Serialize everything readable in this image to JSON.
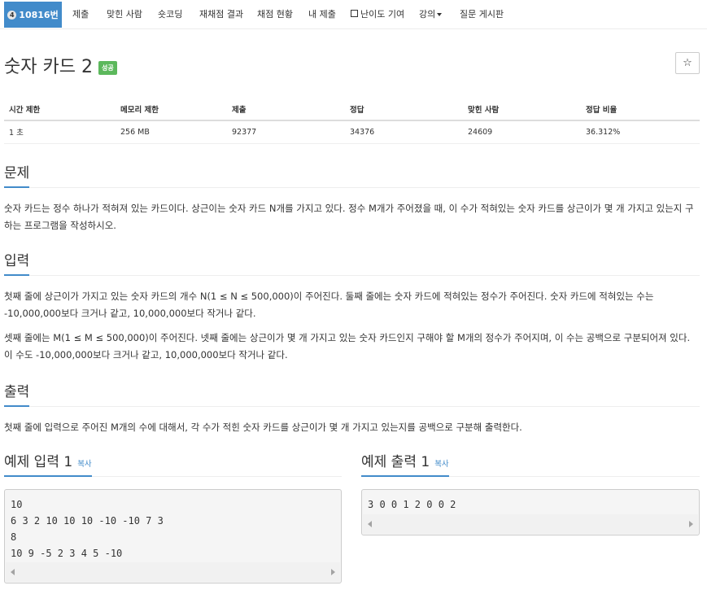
{
  "nav": {
    "problem_id": "10816번",
    "problem_icon": "4",
    "items": [
      "제출",
      "맞힌 사람",
      "숏코딩",
      "재채점 결과",
      "채점 현황",
      "내 제출",
      "난이도 기여",
      "강의",
      "질문 게시판"
    ]
  },
  "problem": {
    "title": "숫자 카드 2",
    "status": "성공",
    "star": "☆"
  },
  "info": {
    "headers": [
      "시간 제한",
      "메모리 제한",
      "제출",
      "정답",
      "맞힌 사람",
      "정답 비율"
    ],
    "values": [
      "1 초",
      "256 MB",
      "92377",
      "34376",
      "24609",
      "36.312%"
    ]
  },
  "sections": {
    "description": {
      "heading": "문제",
      "text": "숫자 카드는 정수 하나가 적혀져 있는 카드이다. 상근이는 숫자 카드 N개를 가지고 있다. 정수 M개가 주어졌을 때, 이 수가 적혀있는 숫자 카드를 상근이가 몇 개 가지고 있는지 구하는 프로그램을 작성하시오."
    },
    "input": {
      "heading": "입력",
      "p1": "첫째 줄에 상근이가 가지고 있는 숫자 카드의 개수 N(1 ≤ N ≤ 500,000)이 주어진다. 둘째 줄에는 숫자 카드에 적혀있는 정수가 주어진다. 숫자 카드에 적혀있는 수는 -10,000,000보다 크거나 같고, 10,000,000보다 작거나 같다.",
      "p2": "셋째 줄에는 M(1 ≤ M ≤ 500,000)이 주어진다. 넷째 줄에는 상근이가 몇 개 가지고 있는 숫자 카드인지 구해야 할 M개의 정수가 주어지며, 이 수는 공백으로 구분되어져 있다. 이 수도 -10,000,000보다 크거나 같고, 10,000,000보다 작거나 같다."
    },
    "output": {
      "heading": "출력",
      "text": "첫째 줄에 입력으로 주어진 M개의 수에 대해서, 각 수가 적힌 숫자 카드를 상근이가 몇 개 가지고 있는지를 공백으로 구분해 출력한다."
    }
  },
  "samples": {
    "input": {
      "heading": "예제 입력 1",
      "copy": "복사",
      "content": "10\n6 3 2 10 10 10 -10 -10 7 3\n8\n10 9 -5 2 3 4 5 -10"
    },
    "output": {
      "heading": "예제 출력 1",
      "copy": "복사",
      "content": "3 0 0 1 2 0 0 2"
    }
  },
  "colors": {
    "accent": "#428bca",
    "success": "#5cb85c"
  }
}
